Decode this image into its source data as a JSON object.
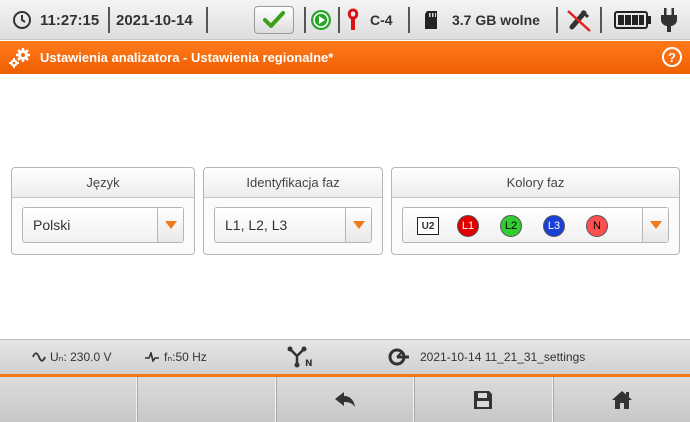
{
  "status": {
    "time": "11:27:15",
    "date": "2021-10-14",
    "clamp_label": "C-4",
    "storage": "3.7 GB wolne"
  },
  "title": {
    "text": "Ustawienia analizatora - Ustawienia regionalne*",
    "help_symbol": "?"
  },
  "panels": {
    "language": {
      "label": "Język",
      "value": "Polski"
    },
    "phase_id": {
      "label": "Identyfikacja faz",
      "value": "L1, L2, L3"
    },
    "phase_colors": {
      "label": "Kolory faz",
      "reference": "U2",
      "phases": [
        {
          "label": "L1",
          "color": "#e00000",
          "text_color": "#ffffff"
        },
        {
          "label": "L2",
          "color": "#33cc33",
          "text_color": "#000000"
        },
        {
          "label": "L3",
          "color": "#1a3fd6",
          "text_color": "#ffffff"
        },
        {
          "label": "N",
          "color": "#ff5050",
          "text_color": "#000000"
        }
      ]
    }
  },
  "infobar": {
    "voltage": "Uₙ: 230.0 V",
    "frequency": "fₙ:50 Hz",
    "config_file": "2021-10-14 11_21_31_settings"
  },
  "softkeys": [
    {
      "name": "empty-1",
      "icon": ""
    },
    {
      "name": "empty-2",
      "icon": ""
    },
    {
      "name": "back",
      "icon": "back-arrow-icon"
    },
    {
      "name": "save",
      "icon": "save-icon"
    },
    {
      "name": "home",
      "icon": "home-icon"
    }
  ],
  "colors": {
    "accent": "#f07a1a",
    "title_bar": "#f26a0a"
  }
}
